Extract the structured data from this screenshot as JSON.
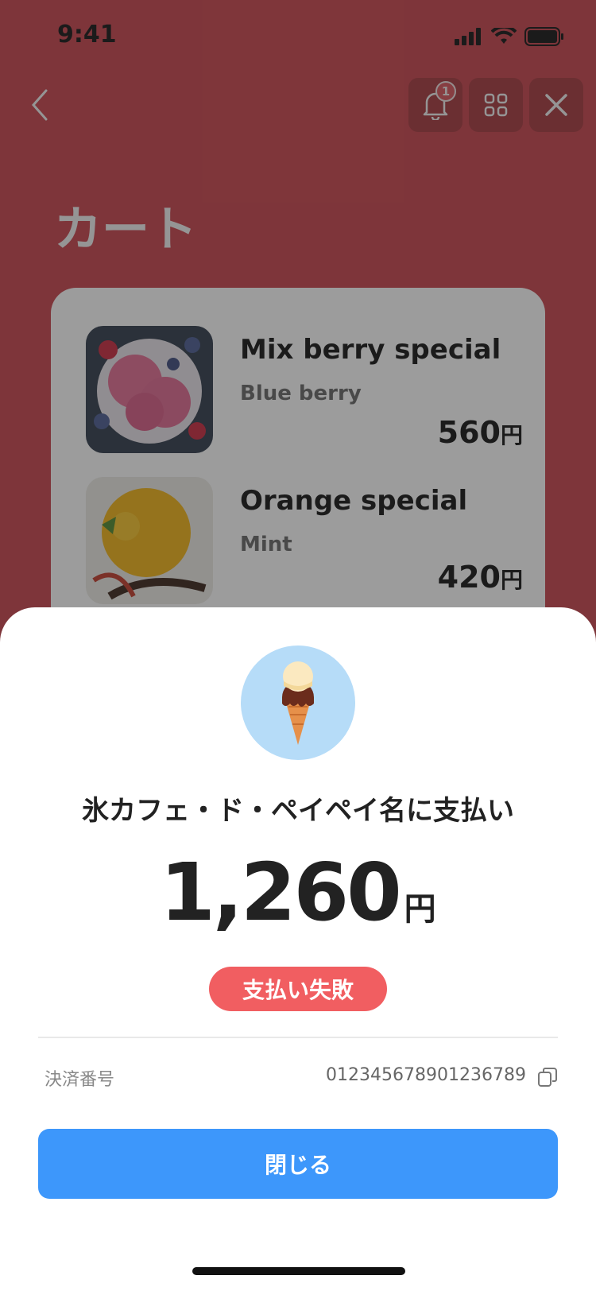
{
  "status_bar": {
    "time": "9:41"
  },
  "header": {
    "title": "カート",
    "notification_count": "1"
  },
  "cart": {
    "items": [
      {
        "name": "Mix berry special",
        "flavor": "Blue berry",
        "price": "560",
        "currency": "円"
      },
      {
        "name": "Orange special",
        "flavor": "Mint",
        "price": "420",
        "currency": "円"
      }
    ]
  },
  "payment_sheet": {
    "merchant_line": "氷カフェ・ド・ペイペイ名に支払い",
    "amount": "1,260",
    "currency": "円",
    "status": "支払い失敗",
    "transaction_label": "決済番号",
    "transaction_number": "012345678901236789",
    "close_label": "閉じる"
  },
  "colors": {
    "background": "#c8424a",
    "status_failed": "#f15e61",
    "primary_button": "#3d97fb",
    "icon_circle": "#b6dcf8"
  },
  "icons": [
    "back-chevron-icon",
    "bell-icon",
    "grid-icon",
    "close-icon",
    "ice-cream-cone-icon",
    "copy-icon"
  ]
}
